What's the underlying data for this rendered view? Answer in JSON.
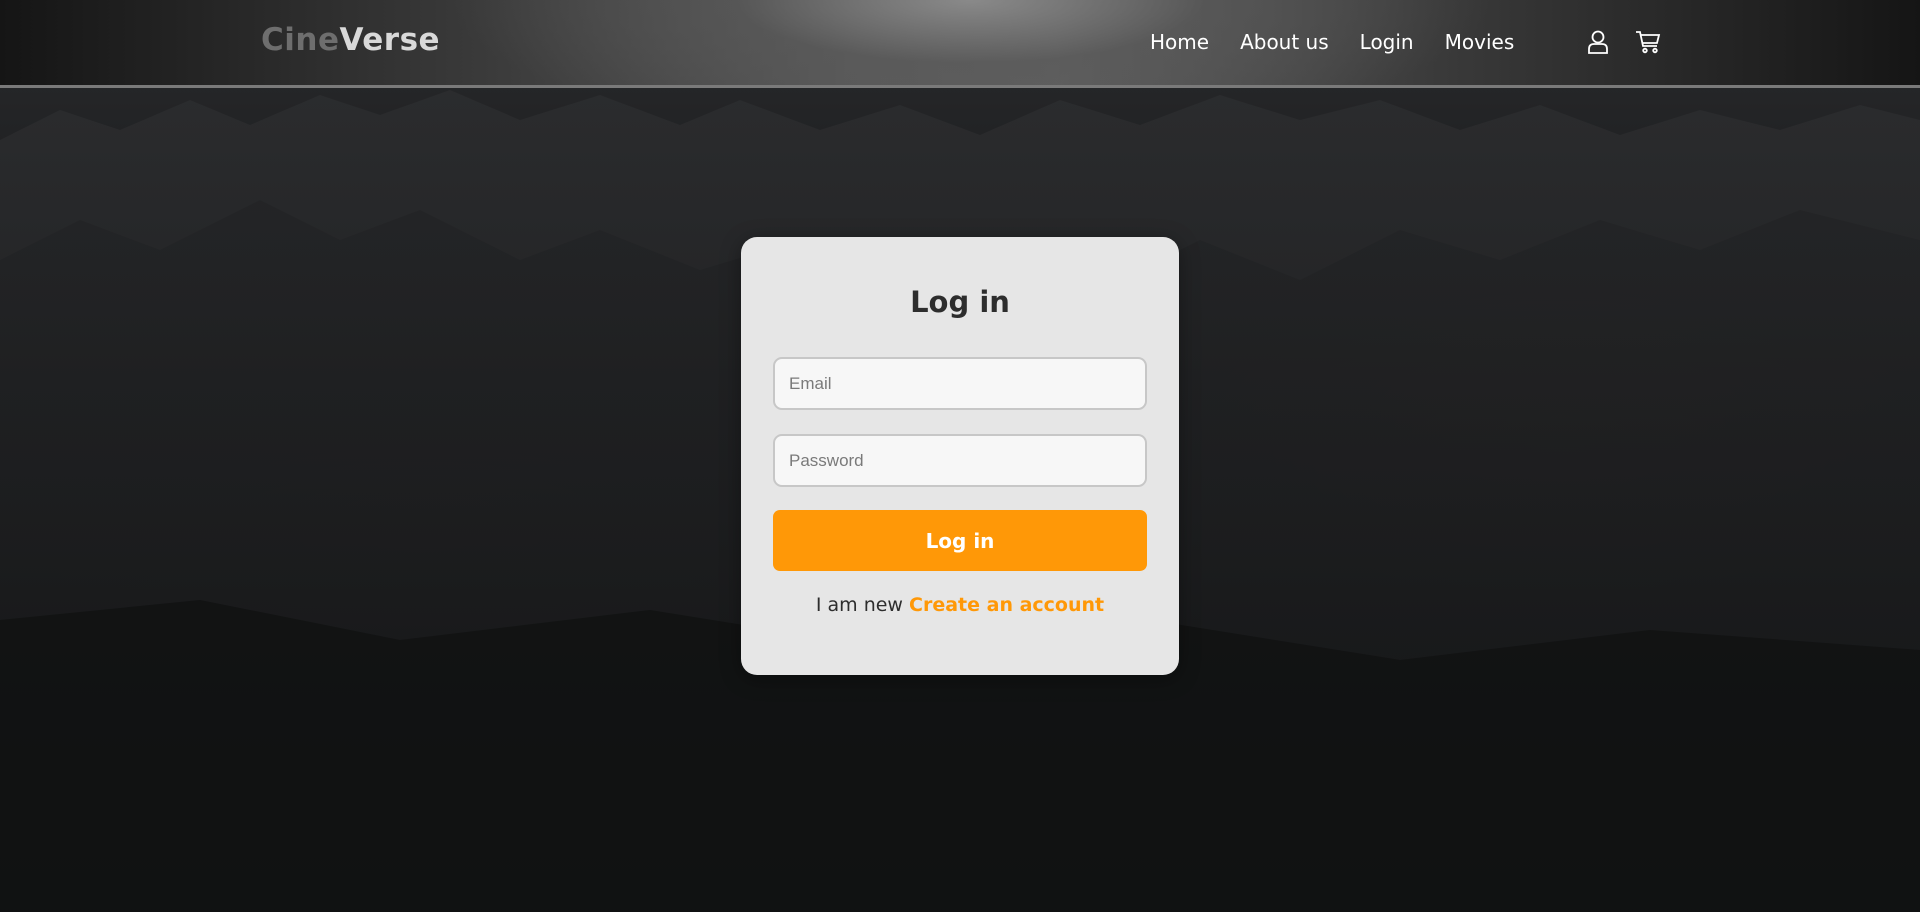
{
  "header": {
    "logo_part1": "Cine",
    "logo_part2": "Verse",
    "nav": [
      {
        "label": "Home"
      },
      {
        "label": "About us"
      },
      {
        "label": "Login"
      },
      {
        "label": "Movies"
      }
    ],
    "icons": [
      "user-icon",
      "cart-icon"
    ]
  },
  "login": {
    "title": "Log in",
    "email_placeholder": "Email",
    "email_value": "",
    "password_placeholder": "Password",
    "password_value": "",
    "submit_label": "Log in",
    "new_text": "I am new",
    "create_account_link": "Create an account"
  },
  "colors": {
    "accent": "#ff9807",
    "card_bg": "#e6e6e6",
    "page_bg": "#131415",
    "text_dark": "#2d2d2d"
  }
}
